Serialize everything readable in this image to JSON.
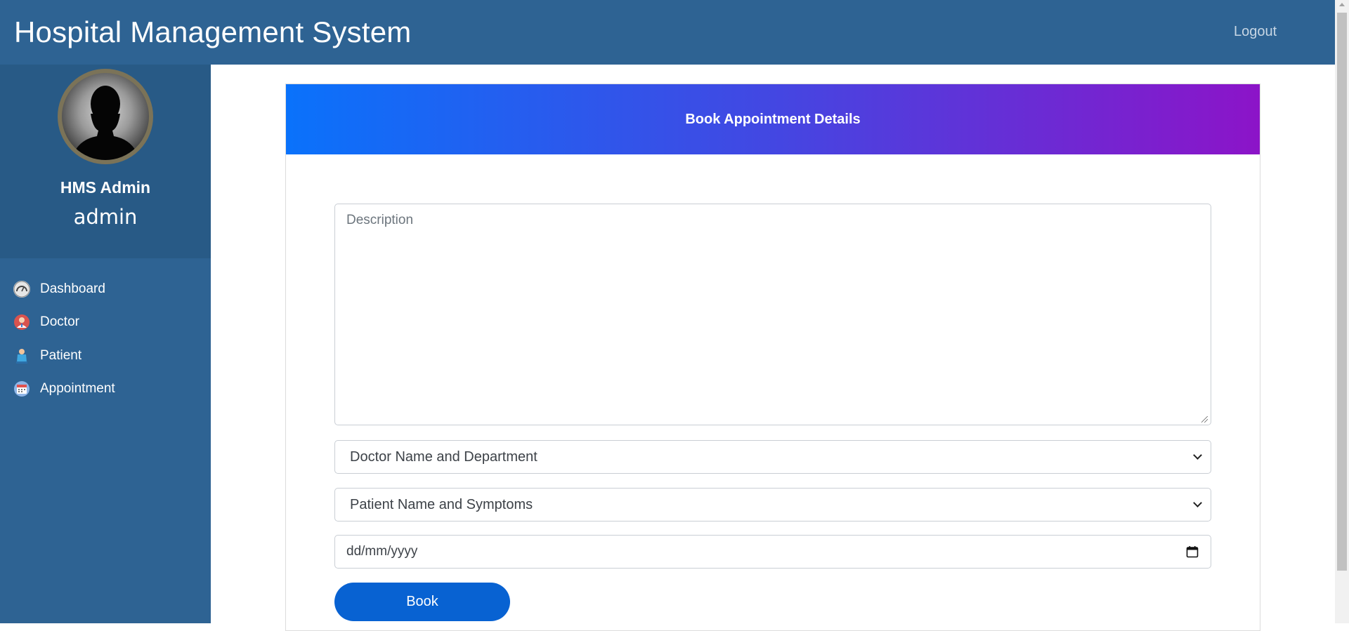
{
  "header": {
    "brand": "Hospital Management System",
    "logout_label": "Logout"
  },
  "profile": {
    "name": "HMS Admin",
    "role": "admin"
  },
  "sidebar": {
    "items": [
      {
        "label": "Dashboard",
        "icon": "dashboard-icon"
      },
      {
        "label": "Doctor",
        "icon": "doctor-icon"
      },
      {
        "label": "Patient",
        "icon": "patient-icon"
      },
      {
        "label": "Appointment",
        "icon": "appointment-icon"
      }
    ]
  },
  "form": {
    "title": "Book Appointment Details",
    "description_placeholder": "Description",
    "doctor_select": "Doctor Name and Department",
    "patient_select": "Patient Name and Symptoms",
    "date_placeholder": "dd/mm/yyyy",
    "submit_label": "Book"
  },
  "colors": {
    "topbar": "#2e6393",
    "sidebar": "#2e6393",
    "profile_panel": "#285a86",
    "header_gradient_start": "#0a72fb",
    "header_gradient_end": "#8c14c8",
    "button": "#0862d2"
  }
}
